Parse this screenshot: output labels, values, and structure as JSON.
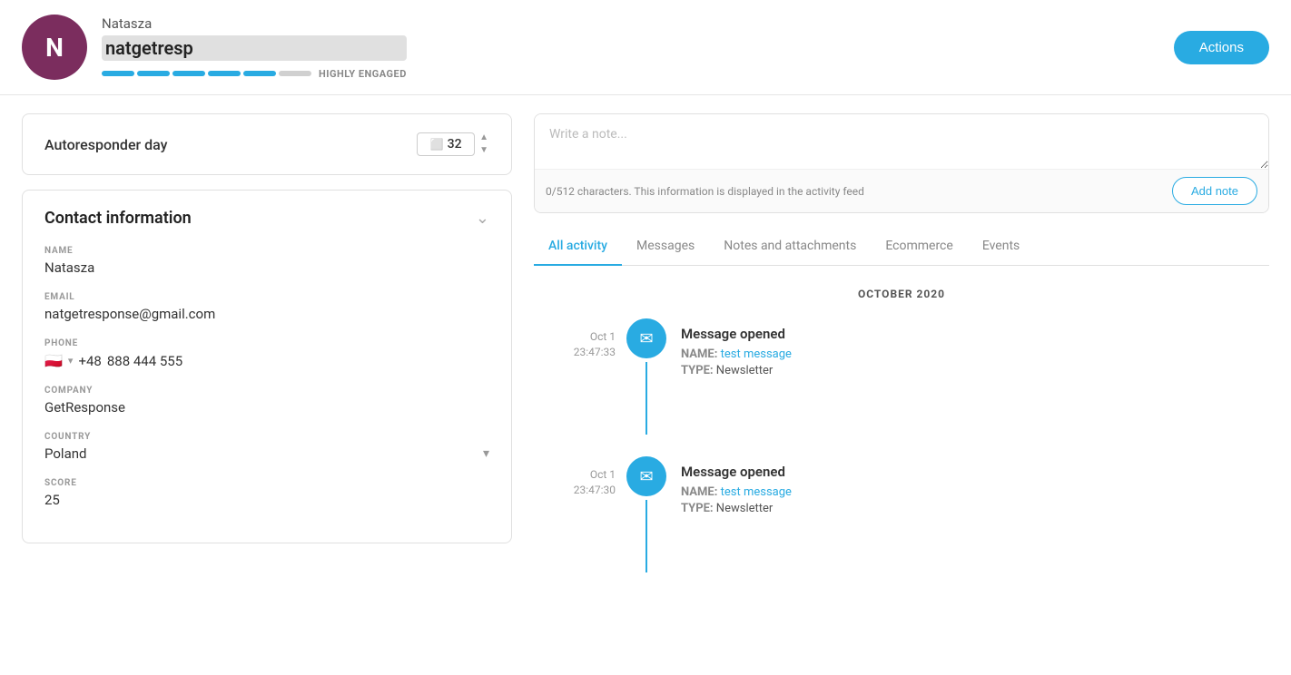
{
  "header": {
    "avatar_letter": "N",
    "name": "Natasza",
    "email_display": "natgetresp",
    "engagement_label": "HIGHLY ENGAGED",
    "engagement_filled": 5,
    "engagement_total": 6,
    "actions_label": "Actions"
  },
  "autoresponder": {
    "label": "Autoresponder day",
    "value": "32"
  },
  "contact_info": {
    "title": "Contact information",
    "fields": {
      "name_label": "NAME",
      "name_value": "Natasza",
      "email_label": "EMAIL",
      "email_value": "natgetresponse@gmail.com",
      "phone_label": "PHONE",
      "phone_flag": "🇵🇱",
      "phone_prefix": "+48",
      "phone_number": "888 444 555",
      "company_label": "COMPANY",
      "company_value": "GetResponse",
      "country_label": "COUNTRY",
      "country_value": "Poland",
      "score_label": "SCORE",
      "score_value": "25"
    }
  },
  "note": {
    "placeholder": "Write a note...",
    "char_info": "0/512 characters. This information is displayed in the activity feed",
    "add_label": "Add note"
  },
  "tabs": [
    {
      "id": "all-activity",
      "label": "All activity",
      "active": true
    },
    {
      "id": "messages",
      "label": "Messages",
      "active": false
    },
    {
      "id": "notes-attachments",
      "label": "Notes and attachments",
      "active": false
    },
    {
      "id": "ecommerce",
      "label": "Ecommerce",
      "active": false
    },
    {
      "id": "events",
      "label": "Events",
      "active": false
    }
  ],
  "activity": {
    "month_label": "OCTOBER 2020",
    "items": [
      {
        "date": "Oct 1",
        "time": "23:47:33",
        "title": "Message opened",
        "name_label": "NAME:",
        "name_value": "test message",
        "type_label": "TYPE:",
        "type_value": "Newsletter"
      },
      {
        "date": "Oct 1",
        "time": "23:47:30",
        "title": "Message opened",
        "name_label": "NAME:",
        "name_value": "test message",
        "type_label": "TYPE:",
        "type_value": "Newsletter"
      }
    ]
  }
}
